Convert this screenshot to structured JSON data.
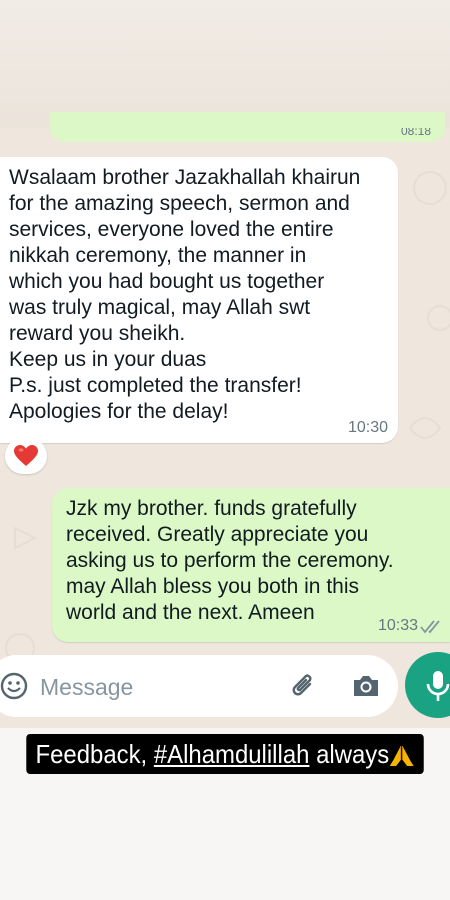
{
  "chat": {
    "previous_time": "08:18",
    "incoming": {
      "text": "Wsalaam brother Jazakhallah khairun\nfor the amazing speech, sermon and\nservices, everyone loved the entire\nnikkah ceremony, the manner in\nwhich you had bought us together\nwas truly magical, may Allah swt\nreward you sheikh.\nKeep us in your duas\nP.s. just completed the transfer!\nApologies for the delay!",
      "time": "10:30",
      "reaction": "heart-icon"
    },
    "outgoing": {
      "text": "Jzk my brother.  funds gratefully\nreceived.  Greatly appreciate you\nasking us to perform the ceremony.\nmay Allah bless you both in this\nworld and the next.  Ameen",
      "time": "10:33",
      "status": "read"
    }
  },
  "composer": {
    "placeholder": "Message"
  },
  "caption": {
    "prefix": "Feedback, ",
    "hashtag": "#Alhamdulillah",
    "suffix": " always"
  },
  "colors": {
    "incoming_bubble": "#ffffff",
    "outgoing_bubble": "#dcf8c6",
    "chat_background": "#efe7de",
    "mic_button": "#1aa383",
    "read_ticks": "#8696a0"
  }
}
